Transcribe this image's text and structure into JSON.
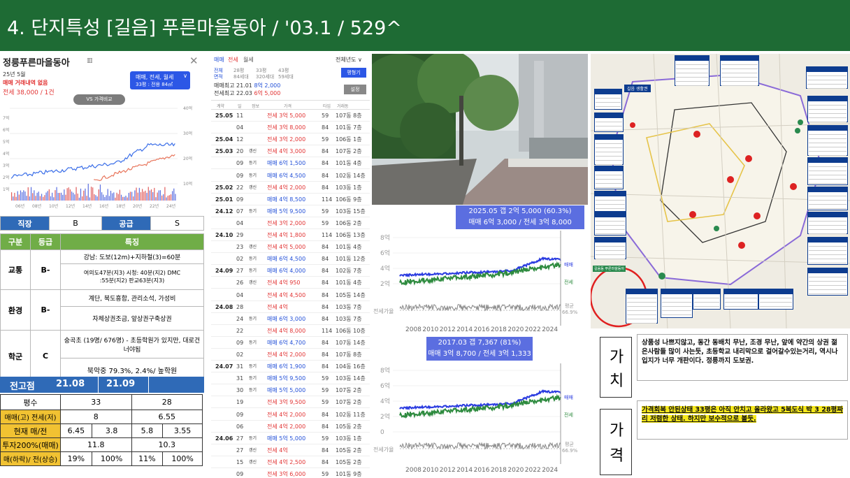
{
  "header": {
    "title": "4. 단지특성 [길음] 푸른마을동아 / '03.1 / 529^"
  },
  "app": {
    "name": "정릉푸른마을동아",
    "date": "25년 5월",
    "no_trade": "매매 거래내역 없음",
    "jeonse_line": "전세 38,000 / 1건",
    "filter_line1": "매매, 전세, 월세",
    "filter_line2": "33평 : 전용 84㎡",
    "vs_button": "VS 가격비교",
    "right_axis": [
      "40억",
      "30억",
      "20억",
      "10억"
    ],
    "left_axis": [
      "7억",
      "6억",
      "5억",
      "4억",
      "3억",
      "2억",
      "1억"
    ],
    "x_axis": [
      "06년",
      "08년",
      "10년",
      "12년",
      "14년",
      "16년",
      "18년",
      "20년",
      "22년",
      "24년"
    ]
  },
  "summary": {
    "jikjang_label": "직장",
    "jikjang_grade": "B",
    "gonggeup_label": "공급",
    "gonggeup_grade": "S",
    "header": [
      "구분",
      "등급",
      "특징"
    ],
    "rows": [
      {
        "cat": "교통",
        "grade": "B-",
        "f1": "강남: 도보(12m)+지하철(3)=60분",
        "f2": "여의도47분(지3) 시청: 40분(지2) DMC :55분(지2) 판교63분(지3)"
      },
      {
        "cat": "환경",
        "grade": "B-",
        "f1": "계단, 북도흥함, 관리소석, 가성비",
        "f2": "자체상권조금, 앞상권구축상권"
      },
      {
        "cat": "학군",
        "grade": "C",
        "f1": "숭곡초 (19명/ 676명) - 초등학원가 있지만, 대로건너야됨",
        "f2": "북악중 79.3%, 2.4%/ 높학원"
      }
    ]
  },
  "peak": {
    "label": "전고점",
    "v1": "21.08",
    "v2": "21.09"
  },
  "bottom_table": {
    "rows": [
      {
        "label": "평수",
        "a": "33",
        "b": "28"
      },
      {
        "label": "매매(고) 전세(저)",
        "a": "8",
        "b": "6.55"
      },
      {
        "label": "현재 매/전",
        "a1": "6.45",
        "a2": "3.8",
        "b1": "5.8",
        "b2": "3.55"
      },
      {
        "label": "투자200%(매매)",
        "a": "11.8",
        "b": "10.3"
      },
      {
        "label": "매(하락)/ 전(상승)",
        "a1": "19%",
        "a2": "100%",
        "b1": "11%",
        "b2": "100%"
      }
    ]
  },
  "tx": {
    "tabs": [
      "매매",
      "전세",
      "월세"
    ],
    "year_filter": "전체년도 ∨",
    "size_tabs": [
      "전체",
      "28평",
      "33평",
      "43평"
    ],
    "size_sub": [
      "면적",
      "84세대",
      "320세대",
      "59세대"
    ],
    "compare_btn": "평형기",
    "max_line1_prefix": "매매최고 21.01",
    "max_line1_val": "8억 2,000",
    "max_line2_prefix": "전세최고 22.03",
    "max_line2_val": "6억 5,000",
    "settings_btn": "설정",
    "cols": [
      "계약",
      "일",
      "정보",
      "가격",
      "타입",
      "거래동"
    ],
    "rows": [
      [
        "25.05",
        "11",
        "",
        "전세 3억 5,000",
        "59",
        "107동 8층",
        "r"
      ],
      [
        "",
        "04",
        "",
        "전세 3억 8,000",
        "84",
        "101동 7층",
        "r"
      ],
      [
        "25.04",
        "12",
        "",
        "전세 3억 2,000",
        "59",
        "106동 1층",
        "r"
      ],
      [
        "25.03",
        "20",
        "갱신",
        "전세 4억 3,000",
        "84",
        "107동 2층",
        "r"
      ],
      [
        "",
        "09",
        "등기",
        "매매 6억 1,500",
        "84",
        "101동 4층",
        "b"
      ],
      [
        "",
        "09",
        "등기",
        "매매 6억 4,500",
        "84",
        "102동 14층",
        "b"
      ],
      [
        "25.02",
        "22",
        "갱신",
        "전세 4억 2,000",
        "84",
        "103동 1층",
        "r"
      ],
      [
        "25.01",
        "09",
        "",
        "매매 4억 8,500",
        "114",
        "106동 9층",
        "b"
      ],
      [
        "24.12",
        "07",
        "등기",
        "매매 5억 9,500",
        "59",
        "103동 15층",
        "b"
      ],
      [
        "",
        "04",
        "",
        "전세 3억 2,000",
        "59",
        "106동 2층",
        "r"
      ],
      [
        "24.10",
        "29",
        "",
        "전세 4억 1,800",
        "114",
        "106동 13층",
        "r"
      ],
      [
        "",
        "23",
        "갱신",
        "전세 4억 5,000",
        "84",
        "101동 4층",
        "r"
      ],
      [
        "",
        "02",
        "등기",
        "매매 6억 4,500",
        "84",
        "101동 12층",
        "b"
      ],
      [
        "24.09",
        "27",
        "등기",
        "매매 6억 4,000",
        "84",
        "102동 7층",
        "b"
      ],
      [
        "",
        "26",
        "갱신",
        "전세 4억 950",
        "84",
        "101동 4층",
        "r"
      ],
      [
        "",
        "04",
        "",
        "전세 4억 4,500",
        "84",
        "105동 14층",
        "r"
      ],
      [
        "24.08",
        "28",
        "",
        "전세 4억",
        "84",
        "103동 7층",
        "r"
      ],
      [
        "",
        "24",
        "등기",
        "매매 6억 3,000",
        "84",
        "103동 7층",
        "b"
      ],
      [
        "",
        "22",
        "",
        "전세 4억 8,000",
        "114",
        "106동 10층",
        "r"
      ],
      [
        "",
        "09",
        "등기",
        "매매 6억 4,700",
        "84",
        "107동 14층",
        "b"
      ],
      [
        "",
        "02",
        "",
        "전세 4억 2,000",
        "84",
        "107동 8층",
        "r"
      ],
      [
        "24.07",
        "31",
        "등기",
        "매매 6억 1,900",
        "84",
        "104동 16층",
        "b"
      ],
      [
        "",
        "31",
        "등기",
        "매매 5억 9,500",
        "59",
        "103동 14층",
        "b"
      ],
      [
        "",
        "30",
        "등기",
        "매매 5억 5,000",
        "59",
        "107동 2층",
        "b"
      ],
      [
        "",
        "19",
        "",
        "전세 3억 9,500",
        "59",
        "107동 2층",
        "r"
      ],
      [
        "",
        "09",
        "",
        "전세 4억 2,000",
        "84",
        "102동 11층",
        "r"
      ],
      [
        "",
        "06",
        "",
        "전세 4억 2,000",
        "84",
        "105동 2층",
        "r"
      ],
      [
        "24.06",
        "27",
        "등기",
        "매매 5억 5,000",
        "59",
        "103동 1층",
        "b"
      ],
      [
        "",
        "27",
        "갱신",
        "전세 4억",
        "84",
        "105동 2층",
        "r"
      ],
      [
        "",
        "15",
        "갱신",
        "전세 4억 2,500",
        "84",
        "105동 2층",
        "r"
      ],
      [
        "",
        "09",
        "",
        "전세 3억 6,000",
        "59",
        "101동 9층",
        "r"
      ]
    ]
  },
  "chart1": {
    "tooltip1": "2025.05  갭 2억 5,000 (60.3%)",
    "tooltip2": "매매 6억 3,000 / 전세 3억 8,000",
    "y_ticks": [
      "8억",
      "6억",
      "4억",
      "2억"
    ],
    "gap_label": "전세가율",
    "right_labels": [
      "매매",
      "전세"
    ],
    "avg_label": "평균",
    "avg_val": "66.9%",
    "x_ticks": [
      "2008",
      "2010",
      "2012",
      "2014",
      "2016",
      "2018",
      "2020",
      "2022",
      "2024"
    ]
  },
  "chart2": {
    "tooltip1": "2017.03  갭 7,367 (81%)",
    "tooltip2": "매매 3억 8,700 / 전세 3억 1,333",
    "y_ticks": [
      "8억",
      "6억",
      "4억",
      "2억",
      "0"
    ],
    "gap_label": "전세가율",
    "right_labels": [
      "매매",
      "전세"
    ],
    "avg_label": "평균",
    "avg_val": "66.9%",
    "x_ticks": [
      "2008",
      "2010",
      "2012",
      "2014",
      "2016",
      "2018",
      "2020",
      "2022",
      "2024"
    ]
  },
  "map": {
    "legend_title": "길음 생활권",
    "highlight": "길음동 푸른마을동아"
  },
  "value_box": {
    "label1": "가",
    "label2": "치",
    "text": "상품성 나쁘지않고, 동간 동배치 무난, 조경 무난, 앞에 약간의 상권 젊은사람들 많이 사는듯, 초등학교 내리막으로 걸어갈수있는거리, 역시나 입지가 너무 개판이다. 정릉까지 도보권."
  },
  "price_box": {
    "label1": "가",
    "label2": "격",
    "text": "가격회복 안된상태 33평은 아직 안치고 올라왔고 5복도식   박 3 28평짜리 저렴한 상태. 하지만 보수적으로 볼듯."
  },
  "colors": {
    "header_green": "#1e6b34",
    "table_blue": "#2f6ab7",
    "table_green": "#70ad47",
    "series_sale": "#2a3be0",
    "series_jeonse": "#2e8b3f"
  }
}
